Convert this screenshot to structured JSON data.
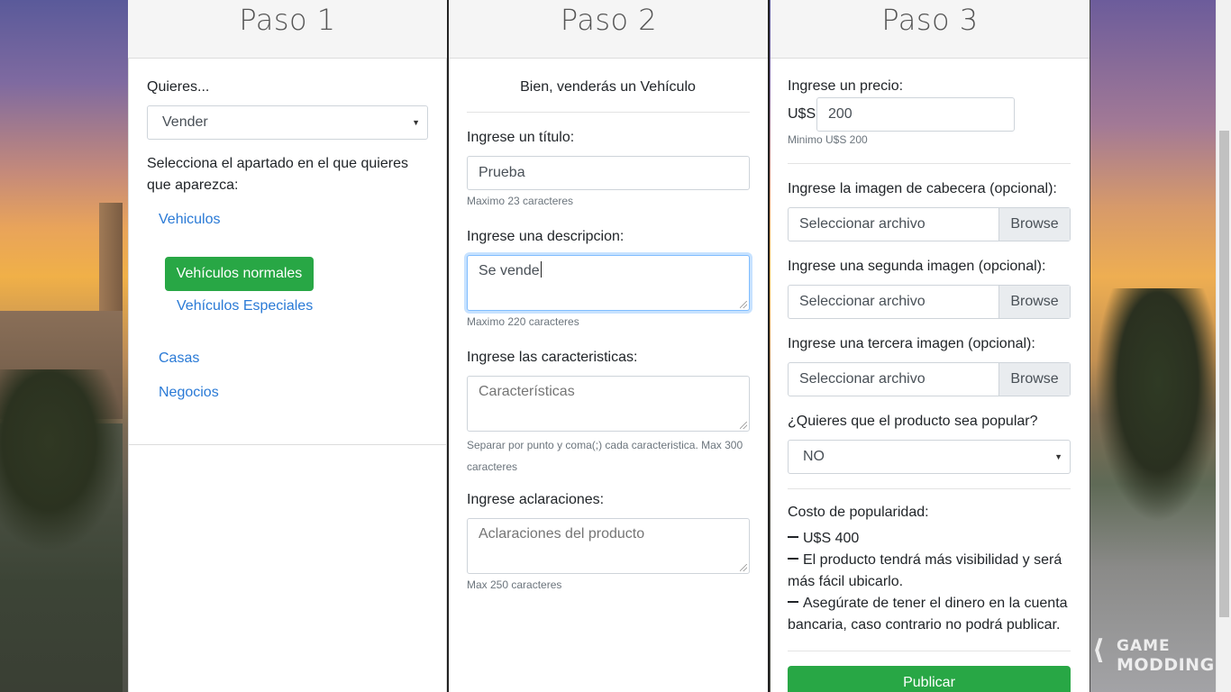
{
  "background": {
    "watermark_line1": "GAME",
    "watermark_line2": "MODDING"
  },
  "step1": {
    "title": "Paso 1",
    "want_label": "Quieres...",
    "want_value": "Vender",
    "section_text": "Selecciona el apartado en el que quieres que aparezca:",
    "categories": {
      "vehiculos": "Vehiculos",
      "normales": "Vehículos normales",
      "especiales": "Vehículos Especiales",
      "casas": "Casas",
      "negocios": "Negocios"
    }
  },
  "step2": {
    "title": "Paso 2",
    "intro": "Bien, venderás un Vehículo",
    "title_label": "Ingrese un título:",
    "title_value": "Prueba",
    "title_help": "Maximo 23 caracteres",
    "desc_label": "Ingrese una descripcion:",
    "desc_value": "Se vende",
    "desc_help": "Maximo 220 caracteres",
    "features_label": "Ingrese las caracteristicas:",
    "features_placeholder": "Características",
    "features_help": "Separar por punto y coma(;) cada caracteristica. Max 300 caracteres",
    "notes_label": "Ingrese aclaraciones:",
    "notes_placeholder": "Aclaraciones del producto",
    "notes_help": "Max 250 caracteres"
  },
  "step3": {
    "title": "Paso 3",
    "price_label": "Ingrese un precio:",
    "currency": "U$S",
    "price_value": "200",
    "price_help": "Minimo U$S 200",
    "image1_label": "Ingrese la imagen de cabecera (opcional):",
    "image2_label": "Ingrese una segunda imagen (opcional):",
    "image3_label": "Ingrese una tercera imagen (opcional):",
    "file_placeholder": "Seleccionar archivo",
    "browse_label": "Browse",
    "popular_label": "¿Quieres que el producto sea popular?",
    "popular_value": "NO",
    "cost_label": "Costo de popularidad:",
    "cost_line1": "U$S 400",
    "cost_line2": "El producto tendrá más visibilidad y será más fácil ubicarlo.",
    "cost_line3": "Asegúrate de tener el dinero en la cuenta bancaria, caso contrario no podrá publicar.",
    "publish_label": "Publicar"
  }
}
